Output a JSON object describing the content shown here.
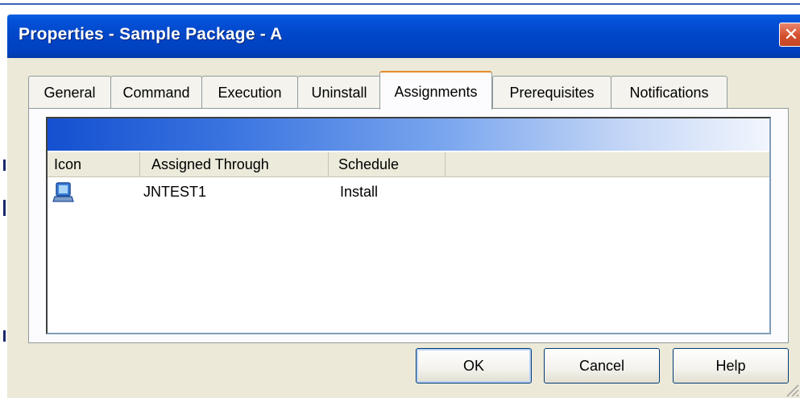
{
  "window": {
    "title": "Properties - Sample Package - A",
    "close_symbol": "✕"
  },
  "tabs": [
    {
      "label": "General",
      "active": false
    },
    {
      "label": "Command",
      "active": false
    },
    {
      "label": "Execution",
      "active": false
    },
    {
      "label": "Uninstall",
      "active": false
    },
    {
      "label": "Assignments",
      "active": true
    },
    {
      "label": "Prerequisites",
      "active": false
    },
    {
      "label": "Notifications",
      "active": false
    }
  ],
  "list": {
    "columns": [
      "Icon",
      "Assigned Through",
      "Schedule"
    ],
    "rows": [
      {
        "icon": "monitor-icon",
        "assigned_through": "JNTEST1",
        "schedule": "Install"
      }
    ]
  },
  "buttons": {
    "ok": "OK",
    "cancel": "Cancel",
    "help": "Help"
  },
  "colors": {
    "titlebar": "#0046c8",
    "dialog_bg": "#ece9d8",
    "active_tab_accent": "#e68b2c",
    "close_button": "#d4502f"
  }
}
